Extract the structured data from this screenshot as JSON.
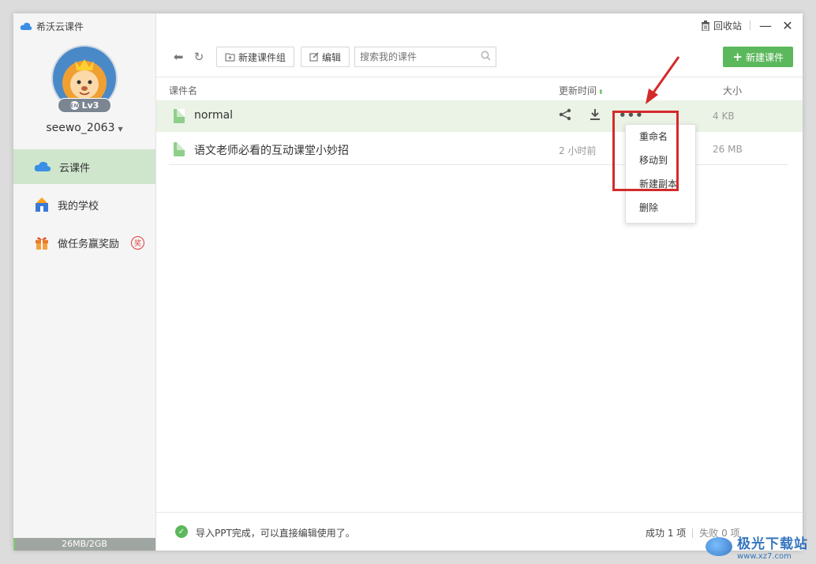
{
  "app": {
    "title": "希沃云课件"
  },
  "user": {
    "name": "seewo_2063",
    "level": "Lv3",
    "level_icon_text": "EN"
  },
  "sidebar": {
    "items": [
      {
        "label": "云课件",
        "active": true
      },
      {
        "label": "我的学校",
        "active": false
      },
      {
        "label": "做任务赢奖励",
        "badge": "奖",
        "active": false
      }
    ],
    "storage": {
      "label": "26MB/2GB",
      "used_fraction": 0.013
    }
  },
  "titlebar": {
    "recycle_label": "回收站"
  },
  "toolbar": {
    "new_group_label": "新建课件组",
    "edit_label": "编辑",
    "search_placeholder": "搜索我的课件",
    "new_courseware_label": "新建课件"
  },
  "table": {
    "headers": {
      "name": "课件名",
      "time": "更新时间",
      "size": "大小"
    },
    "rows": [
      {
        "name": "normal",
        "time": "",
        "size": "4 KB"
      },
      {
        "name": "语文老师必看的互动课堂小妙招",
        "time": "2 小时前",
        "size": "26 MB"
      }
    ]
  },
  "context_menu": {
    "items": [
      "重命名",
      "移动到",
      "新建副本",
      "删除"
    ]
  },
  "status": {
    "message": "导入PPT完成，可以直接编辑使用了。",
    "success": "成功 1 项",
    "fail": "失败 0 项"
  },
  "watermark": {
    "name": "极光下载站",
    "url": "www.xz7.com"
  },
  "colors": {
    "accent": "#5cb85c",
    "highlight": "#d42a2a",
    "active_nav": "#cfe6cc"
  }
}
